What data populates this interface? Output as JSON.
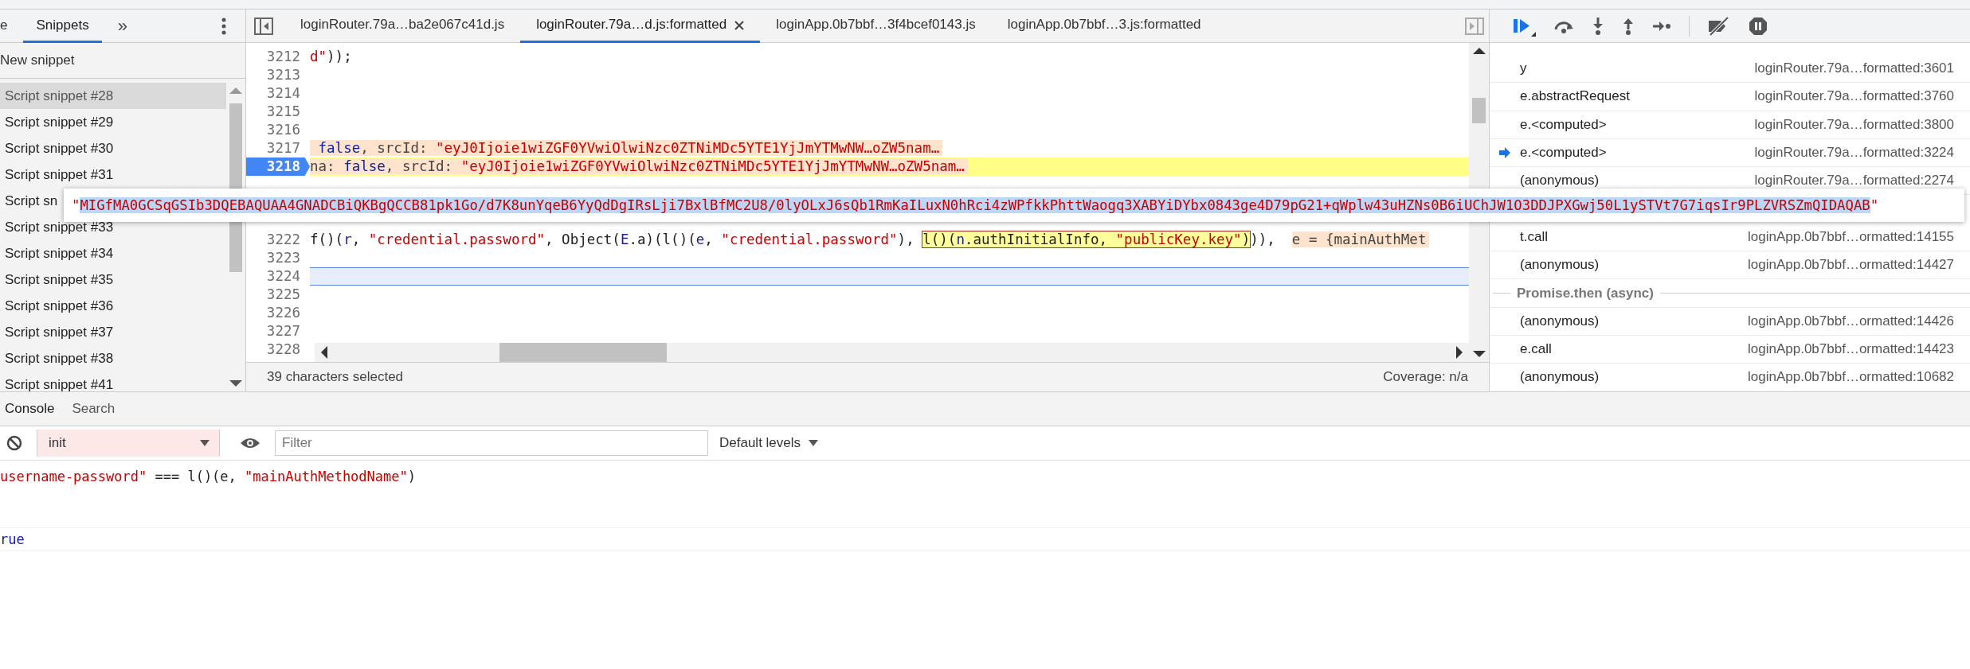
{
  "panel_tabs": [
    {
      "label": "e",
      "selected": false
    },
    {
      "label": "Snippets",
      "selected": true
    }
  ],
  "panel_more": "»",
  "new_snippet": "New snippet",
  "snippets": [
    {
      "label": "Script snippet #28",
      "selected": true
    },
    {
      "label": "Script snippet #29",
      "selected": false
    },
    {
      "label": "Script snippet #30",
      "selected": false
    },
    {
      "label": "Script snippet #31",
      "selected": false
    },
    {
      "label": "Script sn",
      "selected": false
    },
    {
      "label": "Script snippet #33",
      "selected": false
    },
    {
      "label": "Script snippet #34",
      "selected": false
    },
    {
      "label": "Script snippet #35",
      "selected": false
    },
    {
      "label": "Script snippet #36",
      "selected": false
    },
    {
      "label": "Script snippet #37",
      "selected": false
    },
    {
      "label": "Script snippet #38",
      "selected": false
    },
    {
      "label": "Script snippet #41",
      "selected": false
    }
  ],
  "editor_tabs": [
    {
      "label": "loginRouter.79a…ba2e067c41d.js",
      "selected": false,
      "closable": false
    },
    {
      "label": "loginRouter.79a…d.js:formatted",
      "selected": true,
      "closable": true
    },
    {
      "label": "loginApp.0b7bbf…3f4bcef0143.js",
      "selected": false,
      "closable": false
    },
    {
      "label": "loginApp.0b7bbf…3.js:formatted",
      "selected": false,
      "closable": false
    }
  ],
  "code_lines": [
    {
      "number": "3212",
      "paused": false,
      "cursor": false,
      "segments": [
        {
          "text": "d\"",
          "kind": "string"
        },
        {
          "text": "));",
          "kind": "plain"
        }
      ]
    },
    {
      "number": "3213",
      "paused": false,
      "cursor": false
    },
    {
      "number": "3214",
      "paused": false,
      "cursor": false
    },
    {
      "number": "3215",
      "paused": false,
      "cursor": false
    },
    {
      "number": "3216",
      "paused": false,
      "cursor": false
    },
    {
      "number": "3217",
      "paused": false,
      "cursor": false,
      "segments": [
        {
          "kind": "inline_value",
          "segments": [
            {
              "text": " false",
              "kind": "keyword"
            },
            {
              "text": ", srcId: ",
              "kind": "muted"
            },
            {
              "text": "\"eyJ0Ijoie1wiZGF0YVwiOlwiNzc0ZTNiMDc5YTE1YjJmYTMwNW…oZW5nam…",
              "kind": "string"
            }
          ]
        }
      ]
    },
    {
      "number": "3218",
      "paused": true,
      "cursor": false,
      "segments": [
        {
          "kind": "inline_value",
          "segments": [
            {
              "text": "na: ",
              "kind": "muted"
            },
            {
              "text": "false",
              "kind": "keyword"
            },
            {
              "text": ", srcId: ",
              "kind": "muted"
            },
            {
              "text": "\"eyJ0Ijoie1wiZGF0YVwiOlwiNzc0ZTNiMDc5YTE1YjJmYTMwNW…oZW5nam…",
              "kind": "string"
            }
          ]
        }
      ]
    },
    {
      "number": "3222",
      "paused": false,
      "cursor": false,
      "segments": [
        {
          "text": "f()(",
          "kind": "plain"
        },
        {
          "text": "r",
          "kind": "var"
        },
        {
          "text": ", ",
          "kind": "plain"
        },
        {
          "text": "\"credential.password\"",
          "kind": "string"
        },
        {
          "text": ", Object(",
          "kind": "plain"
        },
        {
          "text": "E",
          "kind": "var"
        },
        {
          "text": ".a)(l()(",
          "kind": "plain"
        },
        {
          "text": "e",
          "kind": "var"
        },
        {
          "text": ", ",
          "kind": "plain"
        },
        {
          "text": "\"credential.password\"",
          "kind": "string"
        },
        {
          "text": "), ",
          "kind": "plain"
        },
        {
          "kind": "evaluated",
          "segments": [
            {
              "text": "l()(",
              "kind": "plain"
            },
            {
              "text": "n",
              "kind": "var"
            },
            {
              "text": ".authInitialInfo, ",
              "kind": "plain"
            },
            {
              "text": "\"publicKey.key\"",
              "kind": "string"
            },
            {
              "text": ")",
              "kind": "plain"
            }
          ]
        },
        {
          "text": ")),  ",
          "kind": "plain"
        },
        {
          "kind": "inline_value",
          "segments": [
            {
              "text": "e = {mainAuthMet",
              "kind": "muted"
            }
          ]
        }
      ]
    },
    {
      "number": "3223",
      "paused": false,
      "cursor": false
    },
    {
      "number": "3224",
      "paused": false,
      "cursor": true
    },
    {
      "number": "3225",
      "paused": false,
      "cursor": false
    },
    {
      "number": "3226",
      "paused": false,
      "cursor": false
    },
    {
      "number": "3227",
      "paused": false,
      "cursor": false
    },
    {
      "number": "3228",
      "paused": false,
      "cursor": false
    }
  ],
  "status_bar": {
    "selection": "39 characters selected",
    "coverage": "Coverage: n/a"
  },
  "tooltip": {
    "value": "\"MIGfMA0GCSqGSIb3DQEBAQUAA4GNADCBiQKBgQCCB81pk1Go/d7K8unYqeB6YyQdDgIRsLji7BxlBfMC2U8/0lyOLxJ6sQb1RmKaILuxN0hRci4zWPfkkPhttWaogq3XABYiDYbx0843ge4D79pG21+qWplw43uHZNs0B6iUChJW1O3DDJPXGwj50L1ySTVt7G7iqsIr9PLZVRSZmQIDAQAB\"",
    "selected": true
  },
  "call_stack": [
    {
      "kind": "frame",
      "function": "y",
      "location": "loginRouter.79a…formatted:3601",
      "current": false
    },
    {
      "kind": "frame",
      "function": "e.abstractRequest",
      "location": "loginRouter.79a…formatted:3760",
      "current": false
    },
    {
      "kind": "frame",
      "function": "e.<computed>",
      "location": "loginRouter.79a…formatted:3800",
      "current": false
    },
    {
      "kind": "frame",
      "function": "e.<computed>",
      "location": "loginRouter.79a…formatted:3224",
      "current": true
    },
    {
      "kind": "frame",
      "function": "(anonymous)",
      "location": "loginRouter.79a…formatted:2274",
      "current": false
    },
    {
      "kind": "frame",
      "function": "t.call",
      "location": "loginApp.0b7bbf…ormatted:14155",
      "current": false
    },
    {
      "kind": "frame",
      "function": "(anonymous)",
      "location": "loginApp.0b7bbf…ormatted:14427",
      "current": false
    },
    {
      "kind": "separator",
      "label": "Promise.then (async)"
    },
    {
      "kind": "frame",
      "function": "(anonymous)",
      "location": "loginApp.0b7bbf…ormatted:14426",
      "current": false
    },
    {
      "kind": "frame",
      "function": "e.call",
      "location": "loginApp.0b7bbf…ormatted:14423",
      "current": false
    },
    {
      "kind": "frame",
      "function": "(anonymous)",
      "location": "loginApp.0b7bbf…ormatted:10682",
      "current": false
    }
  ],
  "drawer_tabs": [
    {
      "label": "Console",
      "selected": true
    },
    {
      "label": "Search",
      "selected": false
    }
  ],
  "console_toolbar": {
    "context": "init",
    "filter_placeholder": "Filter",
    "levels": "Default levels"
  },
  "console_lines": [
    {
      "kind": "input",
      "segments": [
        {
          "text": "username-password\"",
          "kind": "string"
        },
        {
          "text": " === l()(e, ",
          "kind": "plain"
        },
        {
          "text": "\"mainAuthMethodName\"",
          "kind": "string"
        },
        {
          "text": ")",
          "kind": "plain"
        }
      ]
    },
    {
      "kind": "result",
      "segments": [
        {
          "text": "rue",
          "kind": "var"
        }
      ]
    }
  ]
}
